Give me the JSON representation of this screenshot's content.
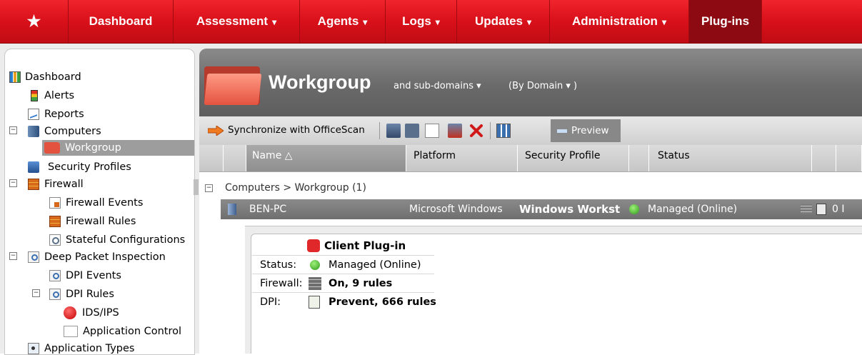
{
  "nav": {
    "star": "★",
    "items": [
      {
        "label": "Dashboard",
        "caret": ""
      },
      {
        "label": "Assessment",
        "caret": "▾"
      },
      {
        "label": "Agents",
        "caret": "▾"
      },
      {
        "label": "Logs",
        "caret": "▾"
      },
      {
        "label": "Updates",
        "caret": "▾"
      },
      {
        "label": "Administration",
        "caret": "▾"
      },
      {
        "label": "Plug-ins",
        "caret": ""
      }
    ],
    "active": "Plug-ins"
  },
  "tree": {
    "dashboard": "Dashboard",
    "alerts": "Alerts",
    "reports": "Reports",
    "computers": "Computers",
    "workgroup": "Workgroup",
    "security_profiles": "Security Profiles",
    "firewall": "Firewall",
    "firewall_events": "Firewall Events",
    "firewall_rules": "Firewall Rules",
    "stateful_configurations": "Stateful Configurations",
    "deep_packet_inspection": "Deep Packet Inspection",
    "dpi_events": "DPI Events",
    "dpi_rules": "DPI Rules",
    "ids_ips": "IDS/IPS",
    "application_control": "Application Control",
    "application_types": "Application Types",
    "collapse_symbol": "−"
  },
  "header": {
    "title": "Workgroup",
    "scope": "and sub-domains ▾",
    "view": "(By Domain ▾ )"
  },
  "toolbar": {
    "sync_label": "Synchronize with OfficeScan",
    "preview_label": "Preview"
  },
  "grid": {
    "columns": [
      "Name △",
      "Platform",
      "Security Profile",
      "Status"
    ],
    "group_label": "Computers > Workgroup (1)",
    "row": {
      "name": "BEN-PC",
      "platform": "Microsoft Windows ",
      "security_profile": "Windows Workst",
      "status": "Managed (Online)",
      "trailing": "0 I"
    }
  },
  "detail": {
    "plugin_title": "Client Plug-in",
    "status_label": "Status:",
    "status_value": "Managed (Online)",
    "firewall_label": "Firewall:",
    "firewall_value": "On, 9 rules",
    "dpi_label": "DPI:",
    "dpi_value": "Prevent, 666 rules"
  },
  "colors": {
    "nav_red": "#d8101a",
    "nav_active": "#8e0a12",
    "header_gray": "#6a6a6a",
    "status_green": "#2e9a18"
  }
}
